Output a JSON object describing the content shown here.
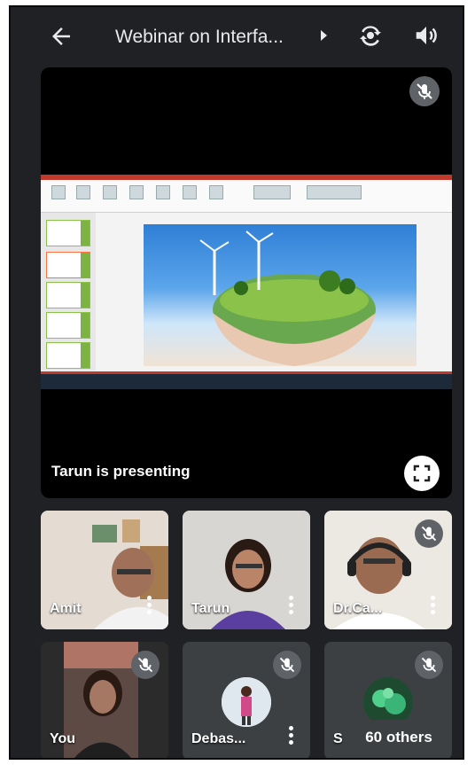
{
  "header": {
    "title": "Webinar on Interfa...",
    "icons": [
      "back-arrow-icon",
      "caret-right-icon",
      "switch-camera-icon",
      "speaker-icon"
    ]
  },
  "main": {
    "presenting_label": "Tarun is presenting",
    "icons": [
      "mic-off-icon",
      "fullscreen-icon"
    ]
  },
  "participants": [
    {
      "name": "Amit",
      "muted": false
    },
    {
      "name": "Tarun",
      "muted": false
    },
    {
      "name": "Dr.Ca...",
      "muted": true
    },
    {
      "name": "You",
      "muted": true
    },
    {
      "name": "Debas...",
      "muted": true
    },
    {
      "name": "S",
      "muted": true
    }
  ],
  "others": {
    "label": "60 others"
  },
  "colors": {
    "background": "#202124",
    "tile": "#3c4043",
    "mute_badge": "#5f6368",
    "text": "#ffffff"
  }
}
